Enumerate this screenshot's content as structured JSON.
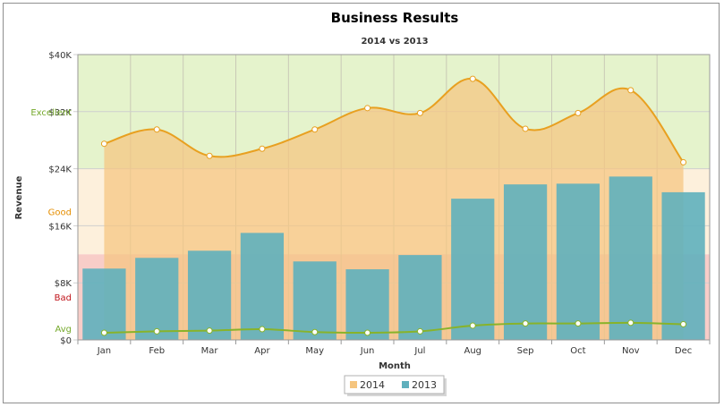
{
  "chart_data": {
    "type": "bar",
    "title": "Business Results",
    "subtitle": "2014 vs 2013",
    "xlabel": "Month",
    "ylabel": "Revenue",
    "categories": [
      "Jan",
      "Feb",
      "Mar",
      "Apr",
      "May",
      "Jun",
      "Jul",
      "Aug",
      "Sep",
      "Oct",
      "Nov",
      "Dec"
    ],
    "ylim": [
      0,
      40000
    ],
    "yticks": [
      {
        "value": 0,
        "label": "$0"
      },
      {
        "value": 8000,
        "label": "$8K"
      },
      {
        "value": 16000,
        "label": "$16K"
      },
      {
        "value": 24000,
        "label": "$24K"
      },
      {
        "value": 32000,
        "label": "$32K"
      },
      {
        "value": 40000,
        "label": "$40K"
      }
    ],
    "grid": true,
    "legend_position": "bottom-center",
    "series": [
      {
        "name": "2014",
        "type": "area",
        "color": "#f5c57f",
        "line_color": "#e8a020",
        "values": [
          27500,
          29500,
          25800,
          26800,
          29500,
          32500,
          31800,
          36600,
          29600,
          31800,
          35000,
          24900
        ]
      },
      {
        "name": "2013",
        "type": "bar",
        "color": "#5fb0bd",
        "values": [
          10000,
          11500,
          12500,
          15000,
          11000,
          9900,
          11900,
          19800,
          21800,
          21900,
          22900,
          20700
        ]
      }
    ],
    "avg_line": {
      "color": "#88b32a",
      "values": [
        1000,
        1200,
        1300,
        1500,
        1100,
        1000,
        1200,
        2000,
        2300,
        2300,
        2400,
        2200
      ]
    },
    "bands": [
      {
        "label": "Excellent",
        "from": 24000,
        "to": 40000,
        "color": "#e5f3cc",
        "label_color": "#74a82a",
        "label_value": 32000
      },
      {
        "label": "Good",
        "from": 12000,
        "to": 24000,
        "color": "#fdf0dc",
        "label_color": "#e58e00",
        "label_value": 18000
      },
      {
        "label": "Bad",
        "from": 0,
        "to": 12000,
        "color": "#f8cdc8",
        "label_color": "#c0131a",
        "label_value": 6000
      }
    ],
    "avg_label": {
      "label": "Avg",
      "color": "#74a82a",
      "value": 1500
    }
  }
}
